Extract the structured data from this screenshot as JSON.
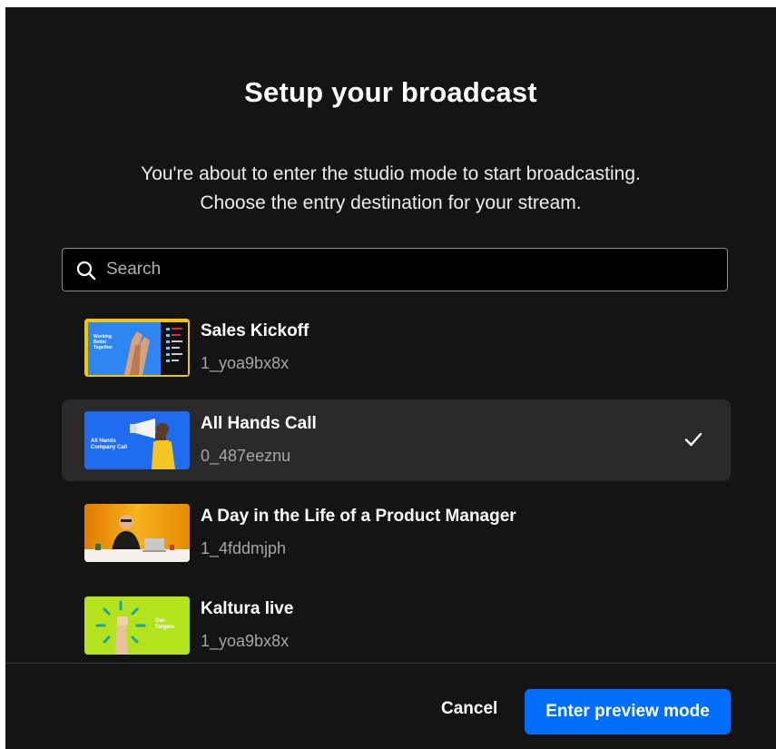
{
  "dialog": {
    "title": "Setup your broadcast",
    "subtitle_line1": "You're about to enter the studio mode to start broadcasting.",
    "subtitle_line2": "Choose the entry destination for your stream."
  },
  "search": {
    "placeholder": "Search",
    "value": "",
    "icon": "search-icon"
  },
  "entries": [
    {
      "title": "Sales Kickoff",
      "id": "1_yoa9bx8x",
      "selected": false,
      "thumb_text": "Working Better Together"
    },
    {
      "title": "All Hands Call",
      "id": "0_487eeznu",
      "selected": true,
      "thumb_text_line1": "All Hands",
      "thumb_text_line2": "Company Call"
    },
    {
      "title": "A Day in the Life of a Product Manager",
      "id": "1_4fddmjph",
      "selected": false
    },
    {
      "title": "Kaltura live",
      "id": "1_yoa9bx8x",
      "selected": false,
      "thumb_text_line1": "Our",
      "thumb_text_line2": "Targets"
    }
  ],
  "footer": {
    "cancel_label": "Cancel",
    "primary_label": "Enter preview mode"
  },
  "colors": {
    "background": "#141414",
    "accent": "#006efa",
    "selected_row": "#2a2a2a",
    "muted_text": "#a6a6a6"
  }
}
